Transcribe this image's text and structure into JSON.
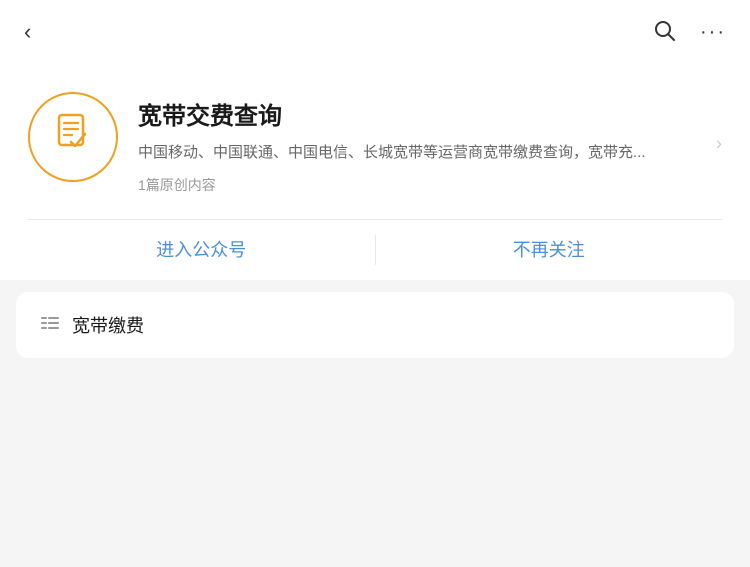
{
  "topBar": {
    "backLabel": "‹",
    "searchAriaLabel": "search",
    "moreAriaLabel": "more options",
    "moreLabel": "···"
  },
  "profile": {
    "name": "宽带交费查询",
    "description": "中国移动、中国联通、中国电信、长城宽带等运营商宽带缴费查询，宽带充...",
    "meta": "1篇原创内容",
    "enterLabel": "进入公众号",
    "unfollowLabel": "不再关注"
  },
  "contentCard": {
    "title": "宽带缴费"
  },
  "colors": {
    "accent": "#f0a020",
    "link": "#4a90d9"
  }
}
